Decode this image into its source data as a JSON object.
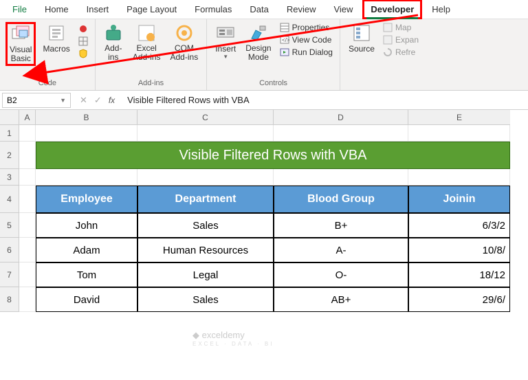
{
  "menu": {
    "tabs": [
      "File",
      "Home",
      "Insert",
      "Page Layout",
      "Formulas",
      "Data",
      "Review",
      "View",
      "Developer",
      "Help"
    ],
    "active": "Developer"
  },
  "ribbon": {
    "code": {
      "label": "Code",
      "visual_basic": "Visual\nBasic",
      "macros": "Macros"
    },
    "addins": {
      "label": "Add-ins",
      "addins_btn": "Add-\nins",
      "excel_addins": "Excel\nAdd-ins",
      "com_addins": "COM\nAdd-ins"
    },
    "controls": {
      "label": "Controls",
      "insert": "Insert",
      "design": "Design\nMode",
      "properties": "Properties",
      "view_code": "View Code",
      "run_dialog": "Run Dialog"
    },
    "xml": {
      "source": "Source",
      "map": "Map",
      "expan": "Expan",
      "refre": "Refre"
    }
  },
  "namebox": {
    "ref": "B2"
  },
  "formula": {
    "text": "Visible Filtered Rows with VBA"
  },
  "grid": {
    "cols": [
      "A",
      "B",
      "C",
      "D",
      "E"
    ],
    "rows": [
      "1",
      "2",
      "3",
      "4",
      "5",
      "6",
      "7",
      "8"
    ],
    "banner": "Visible Filtered Rows with VBA",
    "headers": [
      "Employee",
      "Department",
      "Blood Group",
      "Joinin"
    ],
    "data": [
      {
        "emp": "John",
        "dept": "Sales",
        "blood": "B+",
        "join": "6/3/2"
      },
      {
        "emp": "Adam",
        "dept": "Human Resources",
        "blood": "A-",
        "join": "10/8/"
      },
      {
        "emp": "Tom",
        "dept": "Legal",
        "blood": "O-",
        "join": "18/12"
      },
      {
        "emp": "David",
        "dept": "Sales",
        "blood": "AB+",
        "join": "29/6/"
      }
    ]
  },
  "watermark": {
    "brand": "exceldemy",
    "tag": "EXCEL · DATA · BI"
  }
}
